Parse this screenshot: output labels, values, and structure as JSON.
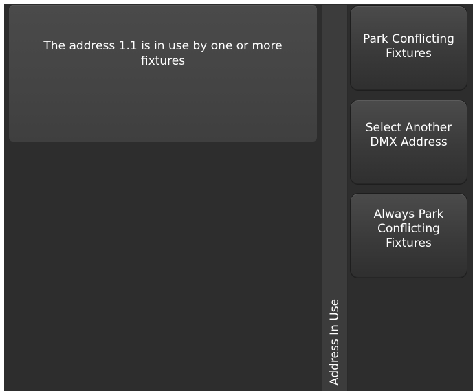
{
  "dialog": {
    "message": "The address 1.1 is in use by one or more fixtures",
    "side_title": "Address In Use"
  },
  "actions": [
    {
      "label": "Park Conflicting Fixtures"
    },
    {
      "label": "Select Another DMX Address"
    },
    {
      "label": "Always Park Conflicting Fixtures"
    }
  ]
}
